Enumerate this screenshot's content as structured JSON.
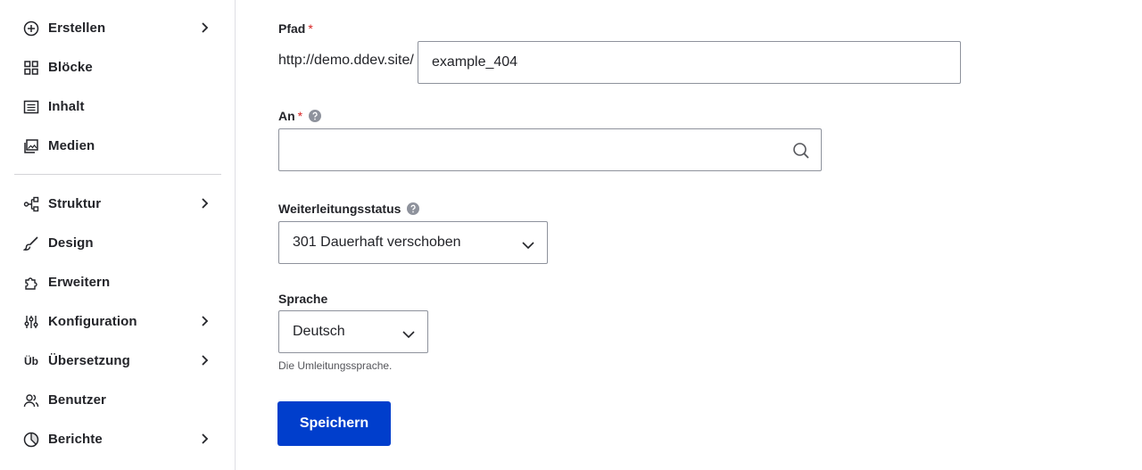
{
  "sidebar": {
    "items": [
      {
        "label": "Erstellen",
        "icon": "plus-circle-icon",
        "has_children": true
      },
      {
        "label": "Blöcke",
        "icon": "blocks-icon",
        "has_children": false
      },
      {
        "label": "Inhalt",
        "icon": "content-list-icon",
        "has_children": false
      },
      {
        "label": "Medien",
        "icon": "media-icon",
        "has_children": false
      },
      {
        "label": "Struktur",
        "icon": "structure-icon",
        "has_children": true
      },
      {
        "label": "Design",
        "icon": "brush-icon",
        "has_children": false
      },
      {
        "label": "Erweitern",
        "icon": "puzzle-icon",
        "has_children": false
      },
      {
        "label": "Konfiguration",
        "icon": "sliders-icon",
        "has_children": true
      },
      {
        "label": "Übersetzung",
        "icon": "translation-icon",
        "icon_text": "Üb",
        "has_children": true
      },
      {
        "label": "Benutzer",
        "icon": "users-icon",
        "has_children": false
      },
      {
        "label": "Berichte",
        "icon": "reports-icon",
        "has_children": true
      }
    ]
  },
  "form": {
    "path": {
      "label": "Pfad",
      "required_mark": "*",
      "prefix": "http://demo.ddev.site/",
      "value": "example_404"
    },
    "to": {
      "label": "An",
      "required_mark": "*",
      "value": ""
    },
    "status": {
      "label": "Weiterleitungsstatus",
      "selected": "301 Dauerhaft verschoben"
    },
    "language": {
      "label": "Sprache",
      "selected": "Deutsch",
      "description": "Die Umleitungssprache."
    },
    "save_label": "Speichern"
  },
  "colors": {
    "primary_button": "#003ecc",
    "required": "#d72222",
    "border": "#8e929c"
  }
}
